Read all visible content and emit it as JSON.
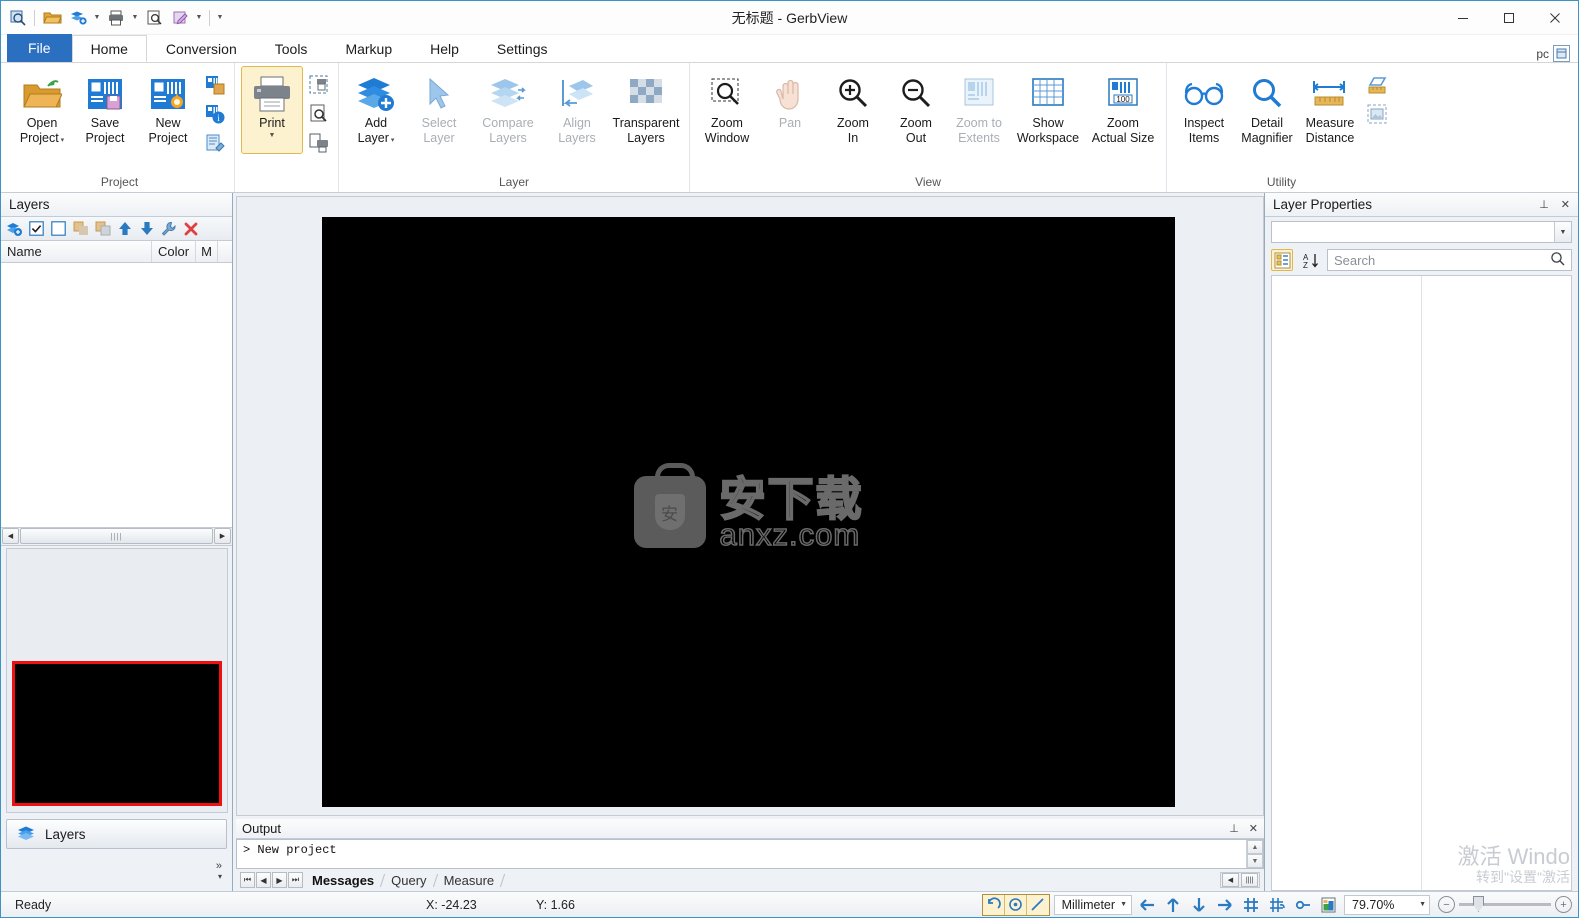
{
  "window": {
    "title": "无标题 - GerbView",
    "minimize_label": "—",
    "maximize_label": "❐",
    "close_label": "✕"
  },
  "quick_access": {
    "items": [
      {
        "name": "app-icon",
        "icon": "gerbview-app-icon"
      },
      {
        "name": "open-project",
        "icon": "folder-open-icon"
      },
      {
        "name": "add-layer",
        "icon": "add-layer-icon"
      },
      {
        "name": "print",
        "icon": "printer-icon"
      },
      {
        "name": "print-preview",
        "icon": "print-preview-icon"
      },
      {
        "name": "markup",
        "icon": "markup-icon"
      },
      {
        "name": "customize",
        "icon": "customize-caret-icon"
      }
    ]
  },
  "tabs": {
    "items": [
      {
        "label": "File",
        "kind": "file"
      },
      {
        "label": "Home",
        "kind": "active"
      },
      {
        "label": "Conversion",
        "kind": "normal"
      },
      {
        "label": "Tools",
        "kind": "normal"
      },
      {
        "label": "Markup",
        "kind": "normal"
      },
      {
        "label": "Help",
        "kind": "normal"
      },
      {
        "label": "Settings",
        "kind": "normal"
      }
    ],
    "right_text": "pc"
  },
  "ribbon": {
    "groups": [
      {
        "name": "project",
        "label": "Project",
        "buttons": [
          {
            "name": "open-project",
            "line1": "Open",
            "line2": "Project",
            "icon": "folder-open-icon",
            "dropdown": true,
            "state": "normal"
          },
          {
            "name": "save-project",
            "line1": "Save",
            "line2": "Project",
            "icon": "save-project-icon",
            "dropdown": false,
            "state": "normal"
          },
          {
            "name": "new-project",
            "line1": "New",
            "line2": "Project",
            "icon": "new-project-icon",
            "dropdown": false,
            "state": "normal"
          }
        ],
        "small_buttons": [
          {
            "name": "project-properties",
            "icon": "project-properties-icon"
          },
          {
            "name": "project-info",
            "icon": "project-info-icon"
          },
          {
            "name": "edit-notes",
            "icon": "edit-notes-icon"
          }
        ]
      },
      {
        "name": "print",
        "label": "",
        "buttons": [
          {
            "name": "print",
            "line1": "Print",
            "line2": "",
            "icon": "printer-icon",
            "dropdown": true,
            "state": "selected"
          }
        ],
        "small_buttons": [
          {
            "name": "print-selection",
            "icon": "print-selection-icon"
          },
          {
            "name": "print-preview",
            "icon": "print-preview-icon"
          },
          {
            "name": "print-setup",
            "icon": "print-setup-icon"
          }
        ]
      },
      {
        "name": "layer",
        "label": "Layer",
        "buttons": [
          {
            "name": "add-layer",
            "line1": "Add",
            "line2": "Layer",
            "icon": "add-layer-icon",
            "dropdown": true,
            "state": "normal"
          },
          {
            "name": "select-layer",
            "line1": "Select",
            "line2": "Layer",
            "icon": "select-layer-icon",
            "dropdown": false,
            "state": "disabled"
          },
          {
            "name": "compare-layers",
            "line1": "Compare",
            "line2": "Layers",
            "icon": "compare-layers-icon",
            "dropdown": false,
            "state": "disabled"
          },
          {
            "name": "align-layers",
            "line1": "Align",
            "line2": "Layers",
            "icon": "align-layers-icon",
            "dropdown": false,
            "state": "disabled"
          },
          {
            "name": "transparent-layers",
            "line1": "Transparent",
            "line2": "Layers",
            "icon": "transparent-layers-icon",
            "dropdown": false,
            "state": "normal"
          }
        ],
        "small_buttons": []
      },
      {
        "name": "view",
        "label": "View",
        "buttons": [
          {
            "name": "zoom-window",
            "line1": "Zoom",
            "line2": "Window",
            "icon": "zoom-window-icon",
            "dropdown": false,
            "state": "normal"
          },
          {
            "name": "pan",
            "line1": "Pan",
            "line2": "",
            "icon": "pan-hand-icon",
            "dropdown": false,
            "state": "disabled"
          },
          {
            "name": "zoom-in",
            "line1": "Zoom",
            "line2": "In",
            "icon": "zoom-in-icon",
            "dropdown": false,
            "state": "normal"
          },
          {
            "name": "zoom-out",
            "line1": "Zoom",
            "line2": "Out",
            "icon": "zoom-out-icon",
            "dropdown": false,
            "state": "normal"
          },
          {
            "name": "zoom-to-extents",
            "line1": "Zoom to",
            "line2": "Extents",
            "icon": "zoom-extents-icon",
            "dropdown": false,
            "state": "disabled"
          },
          {
            "name": "show-workspace",
            "line1": "Show",
            "line2": "Workspace",
            "icon": "workspace-grid-icon",
            "dropdown": false,
            "state": "normal"
          },
          {
            "name": "zoom-actual-size",
            "line1": "Zoom",
            "line2": "Actual Size",
            "icon": "zoom-actual-size-icon",
            "dropdown": false,
            "state": "normal"
          }
        ],
        "small_buttons": []
      },
      {
        "name": "utility",
        "label": "Utility",
        "buttons": [
          {
            "name": "inspect-items",
            "line1": "Inspect",
            "line2": "Items",
            "icon": "glasses-icon",
            "dropdown": false,
            "state": "normal"
          },
          {
            "name": "detail-magnifier",
            "line1": "Detail",
            "line2": "Magnifier",
            "icon": "magnifier-icon",
            "dropdown": false,
            "state": "normal"
          },
          {
            "name": "measure-distance",
            "line1": "Measure",
            "line2": "Distance",
            "icon": "measure-distance-icon",
            "dropdown": false,
            "state": "normal"
          }
        ],
        "small_buttons": [
          {
            "name": "measure-area",
            "icon": "measure-area-icon"
          },
          {
            "name": "snapshot",
            "icon": "snapshot-icon"
          }
        ]
      }
    ]
  },
  "layers_panel": {
    "title": "Layers",
    "toolbar": [
      {
        "name": "add-layer-button",
        "icon": "add-layer-icon"
      },
      {
        "name": "check-all-button",
        "icon": "checkbox-checked-icon"
      },
      {
        "name": "uncheck-all-button",
        "icon": "checkbox-empty-icon"
      },
      {
        "name": "merge-layers-button",
        "icon": "merge-layers-icon"
      },
      {
        "name": "split-layers-button",
        "icon": "split-layers-icon"
      },
      {
        "name": "move-up-button",
        "icon": "arrow-up-icon"
      },
      {
        "name": "move-down-button",
        "icon": "arrow-down-icon"
      },
      {
        "name": "layer-settings-button",
        "icon": "wrench-icon"
      },
      {
        "name": "delete-layer-button",
        "icon": "delete-x-icon"
      }
    ],
    "columns": [
      "Name",
      "Color",
      "M"
    ],
    "rows": [],
    "tab_button": "Layers",
    "overflow_label": "»"
  },
  "canvas": {
    "watermark": {
      "chinese": "安下载",
      "english": "anxz.com",
      "bag_glyph": "安"
    }
  },
  "output_panel": {
    "title": "Output",
    "pin_label": "⊥",
    "close_label": "✕",
    "lines": [
      "> New project"
    ],
    "nav_buttons": [
      "⏮",
      "◀",
      "▶",
      "⏭"
    ],
    "tabs": [
      {
        "label": "Messages",
        "active": true
      },
      {
        "label": "Query",
        "active": false
      },
      {
        "label": "Measure",
        "active": false
      }
    ]
  },
  "layer_properties": {
    "title": "Layer Properties",
    "pin_label": "⊥",
    "close_label": "✕",
    "combo_value": "",
    "toolbar": [
      {
        "name": "categorized-view-button",
        "icon": "categorized-icon",
        "active": true
      },
      {
        "name": "alphabetical-sort-button",
        "icon": "sort-az-icon",
        "active": false
      }
    ],
    "search_placeholder": "Search",
    "search_value": "",
    "search_icon": "search-icon"
  },
  "statusbar": {
    "ready_text": "Ready",
    "x_label": "X: -24.23",
    "y_label": "Y: 1.66",
    "toggles": [
      {
        "name": "toggle-arc-mode",
        "icon": "arc-icon"
      },
      {
        "name": "toggle-center-snap",
        "icon": "center-snap-icon"
      },
      {
        "name": "toggle-line-snap",
        "icon": "line-snap-icon"
      }
    ],
    "unit": "Millimeter",
    "unit_caret": "▾",
    "nav_icons": [
      {
        "name": "pan-left-icon",
        "glyph": "←"
      },
      {
        "name": "pan-up-icon",
        "glyph": "↑"
      },
      {
        "name": "pan-down-icon",
        "glyph": "↓"
      },
      {
        "name": "pan-right-icon",
        "glyph": "→"
      },
      {
        "name": "grid-icon",
        "glyph": "grid"
      },
      {
        "name": "snap-grid-icon",
        "glyph": "snapgrid"
      },
      {
        "name": "origin-icon",
        "glyph": "origin"
      },
      {
        "name": "image-icon",
        "glyph": "image"
      }
    ],
    "zoom_value": "79.70%",
    "zoom_caret": "▾",
    "zoom_out_label": "−",
    "zoom_in_label": "+"
  },
  "activation_watermark": {
    "line1": "激活 Windo",
    "line2": "转到\"设置\"激活"
  },
  "colors": {
    "accent_blue": "#2b6fc0",
    "ribbon_selected": "#fdf2d0",
    "ribbon_selected_border": "#e0b94e",
    "canvas_black": "#000000",
    "thumbnail_border_red": "#ee1111",
    "panel_bg": "#eef1f5"
  }
}
